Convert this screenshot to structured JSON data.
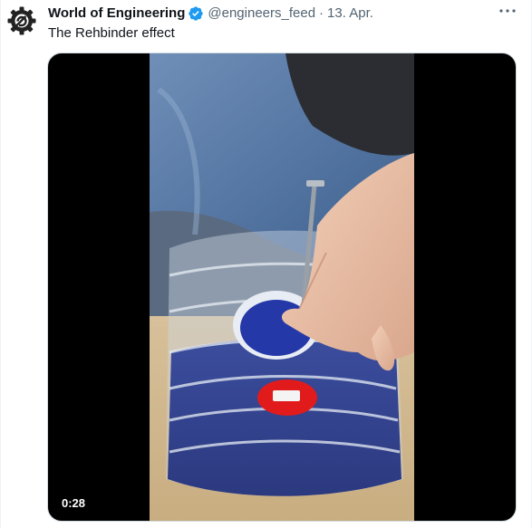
{
  "author": {
    "display_name": "World of Engineering",
    "handle": "@engineers_feed",
    "separator": "·",
    "date": "13. Apr.",
    "avatar_icon": "gear-logo-icon",
    "verified_icon": "verified-badge-icon",
    "verified_color": "#1d9bf0"
  },
  "tweet": {
    "text": "The Rehbinder effect"
  },
  "media": {
    "type": "video",
    "duration": "0:28"
  },
  "menu": {
    "icon": "more-horizontal-icon"
  },
  "colors": {
    "text_primary": "#0f1419",
    "text_secondary": "#536471",
    "media_background": "#000000"
  }
}
